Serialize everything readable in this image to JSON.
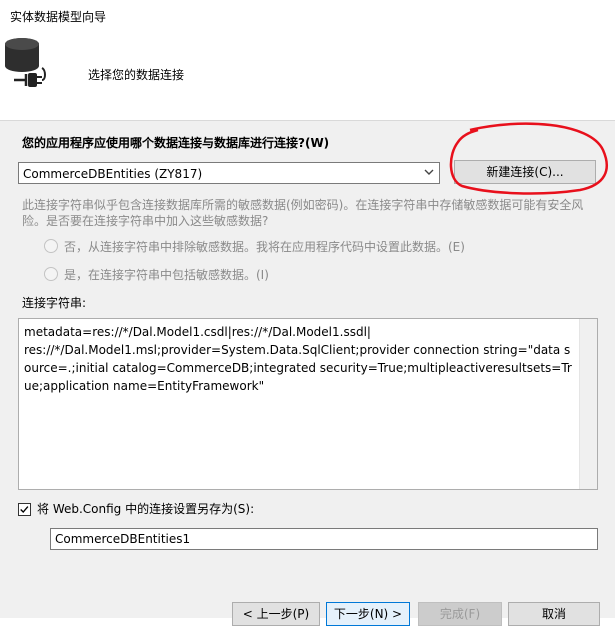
{
  "window": {
    "title": "实体数据模型向导"
  },
  "header": {
    "title": "选择您的数据连接",
    "icon": "database-plug-icon"
  },
  "question": "您的应用程序应使用哪个数据连接与数据库进行连接?(W)",
  "connection_combo": {
    "selected": "CommerceDBEntities (ZY817)",
    "icon": "chevron-down-icon"
  },
  "new_connection_button": "新建连接(C)...",
  "sensitive_note": "此连接字符串似乎包含连接数据库所需的敏感数据(例如密码)。在连接字符串中存储敏感数据可能有安全风险。是否要在连接字符串中加入这些敏感数据?",
  "options": {
    "exclude": "否，从连接字符串中排除敏感数据。我将在应用程序代码中设置此数据。(E)",
    "include": "是，在连接字符串中包括敏感数据。(I)"
  },
  "connection_string_label": "连接字符串:",
  "connection_string": "metadata=res://*/Dal.Model1.csdl|res://*/Dal.Model1.ssdl|\nres://*/Dal.Model1.msl;provider=System.Data.SqlClient;provider connection string=\"data source=.;initial catalog=CommerceDB;integrated security=True;multipleactiveresultsets=True;application name=EntityFramework\"",
  "save_checkbox": {
    "label": "将 Web.Config 中的连接设置另存为(S):",
    "checked": true
  },
  "entity_name_value": "CommerceDBEntities1",
  "buttons": {
    "prev": "< 上一步(P)",
    "next": "下一步(N) >",
    "finish": "完成(F)",
    "cancel": "取消"
  },
  "colors": {
    "annotation": "#e8101c",
    "accent": "#0078d7"
  }
}
